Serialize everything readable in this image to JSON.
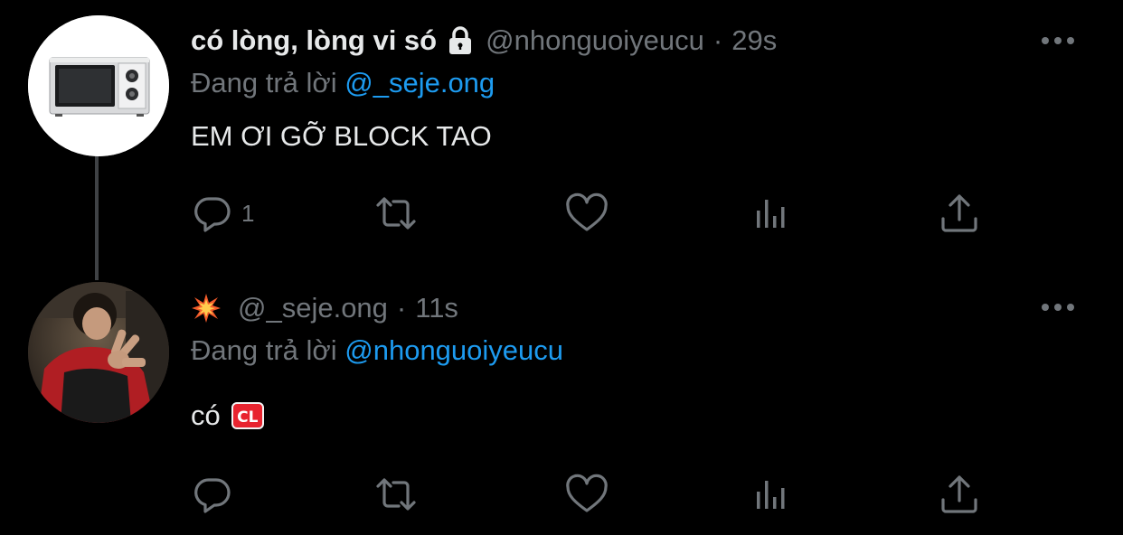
{
  "tweets": [
    {
      "display_name": "có lòng, lòng vi só",
      "protected": true,
      "handle": "@nhonguoiyeucu",
      "separator": "·",
      "time": "29s",
      "reply_prefix": "Đang trả lời",
      "reply_to": "@_seje.ong",
      "text": "EM ƠI GỠ BLOCK TAO",
      "reply_count": "1",
      "avatar": "microwave-oven-icon"
    },
    {
      "display_name_emoji": "collision-emoji-icon",
      "handle": "@_seje.ong",
      "separator": "·",
      "time": "11s",
      "reply_prefix": "Đang trả lời",
      "reply_to": "@nhonguoiyeucu",
      "text": "có",
      "text_badge": "CL",
      "reply_count": "",
      "avatar": "user-photo"
    }
  ],
  "colors": {
    "background": "#000000",
    "text_primary": "#e7e9ea",
    "text_secondary": "#71767b",
    "link": "#1d9bf0",
    "thread_line": "#3f4245"
  },
  "icons": {
    "reply": "comment-icon",
    "retweet": "retweet-icon",
    "like": "heart-icon",
    "views": "analytics-icon",
    "share": "share-icon",
    "more": "more-options-icon",
    "lock": "lock-icon"
  }
}
